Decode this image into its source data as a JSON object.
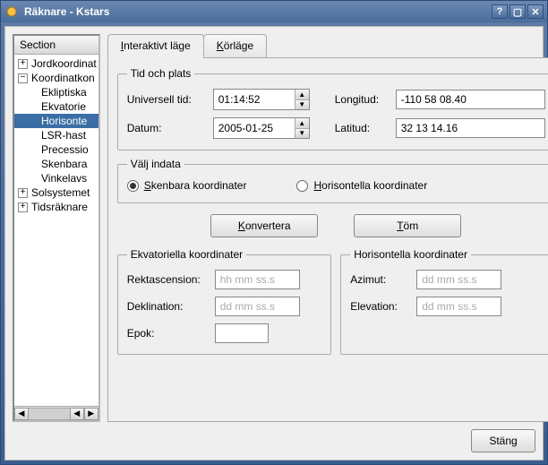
{
  "window": {
    "title": "Räknare - Kstars"
  },
  "section": {
    "header": "Section",
    "nodes": [
      {
        "label": "Jordkoordinat",
        "exp": "+",
        "level": 0
      },
      {
        "label": "Koordinatkon",
        "exp": "-",
        "level": 0
      },
      {
        "label": "Ekliptiska",
        "level": 1
      },
      {
        "label": "Ekvatorie",
        "level": 1
      },
      {
        "label": "Horisonte",
        "level": 1,
        "selected": true
      },
      {
        "label": "LSR-hast",
        "level": 1
      },
      {
        "label": "Precessio",
        "level": 1
      },
      {
        "label": "Skenbara",
        "level": 1
      },
      {
        "label": "Vinkelavs",
        "level": 1
      },
      {
        "label": "Solsystemet",
        "exp": "+",
        "level": 0
      },
      {
        "label": "Tidsräknare",
        "exp": "+",
        "level": 0
      }
    ]
  },
  "tabs": {
    "interactive": "Interaktivt läge",
    "batch": "Körläge"
  },
  "timeplace": {
    "legend": "Tid och plats",
    "ut_label": "Universell tid:",
    "ut_value": "01:14:52",
    "date_label": "Datum:",
    "date_value": "2005-01-25",
    "long_label": "Longitud:",
    "long_value": "-110 58 08.40",
    "lat_label": "Latitud:",
    "lat_value": "32 13 14.16"
  },
  "input": {
    "legend": "Välj indata",
    "radio_app": "Skenbara koordinater",
    "radio_hor": "Horisontella koordinater"
  },
  "buttons": {
    "convert": "Konvertera",
    "clear": "Töm",
    "close": "Stäng"
  },
  "eq": {
    "legend": "Ekvatoriella koordinater",
    "ra_label": "Rektascension:",
    "ra_ph": "hh mm ss.s",
    "dec_label": "Deklination:",
    "dec_ph": "dd mm ss.s",
    "epoch_label": "Epok:"
  },
  "hor": {
    "legend": "Horisontella koordinater",
    "az_label": "Azimut:",
    "az_ph": "dd mm ss.s",
    "el_label": "Elevation:",
    "el_ph": "dd mm ss.s"
  }
}
